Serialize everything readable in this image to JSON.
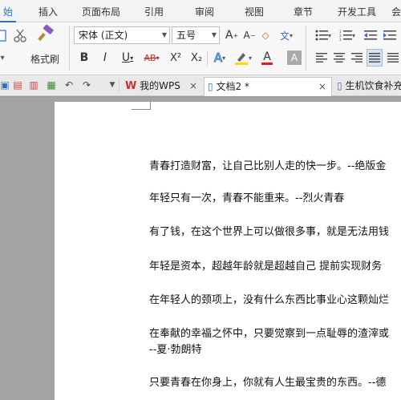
{
  "menu": {
    "items": [
      {
        "label": "始",
        "active": true
      },
      {
        "label": "插入",
        "active": false
      },
      {
        "label": "页面布局",
        "active": false
      },
      {
        "label": "引用",
        "active": false
      },
      {
        "label": "审阅",
        "active": false
      },
      {
        "label": "视图",
        "active": false
      },
      {
        "label": "章节",
        "active": false
      },
      {
        "label": "开发工具",
        "active": false
      },
      {
        "label": "会",
        "active": false
      }
    ]
  },
  "ribbon": {
    "format_painter_label": "格式刷",
    "font_name": "宋体 (正文)",
    "font_size": "五号",
    "bold": "B",
    "italic": "I",
    "underline": "U",
    "strike": "AB",
    "superscript": "X²",
    "subscript": "X₂",
    "font_color": "A",
    "highlight_color": "#ffd800",
    "text_color": "#e02020",
    "accent": "#2f6fc8"
  },
  "tabs": {
    "my_wps": "我的WPS",
    "doc2": "文档2 *",
    "doc3": "生机饮食补充"
  },
  "document": {
    "lines": [
      "青春打造财富，让自己比别人走的快一步。--绝版金",
      "年轻只有一次，青春不能重来。--烈火青春",
      "有了钱，在这个世界上可以做很多事，就是无法用钱",
      "年轻是资本，超越年龄就是超越自己 提前实现财务",
      "在年轻人的颈项上，没有什么东西比事业心这颗灿烂",
      "在奉献的幸福之怀中，只要觉察到一点耻辱的渣滓或",
      "--夏·勃朗特",
      "只要青春在你身上，你就有人生最宝贵的东西。--德"
    ]
  }
}
